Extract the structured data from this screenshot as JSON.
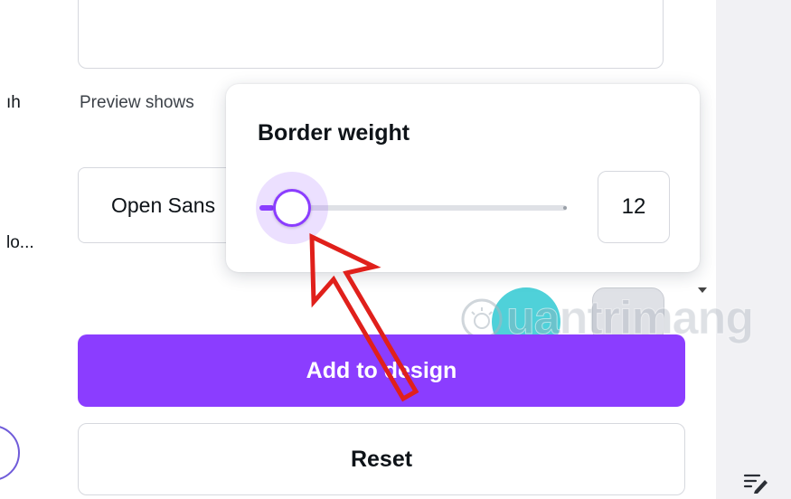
{
  "panel": {
    "left_label_1": "ıh",
    "left_label_2": "lo...",
    "preview_text": "Preview shows",
    "font_value": "Open Sans",
    "add_button_label": "Add to design",
    "reset_button_label": "Reset"
  },
  "popover": {
    "title": "Border weight",
    "slider_value": "12",
    "slider_fraction": 0.12
  },
  "colors": {
    "accent": "#8b3dff",
    "teal_swatch": "#4fd1d9",
    "grey_swatch": "#dfe1e6",
    "annotation_arrow": "#e0201b"
  },
  "watermark": {
    "text": "uantrimang"
  },
  "icons": {
    "notes": "notes-pencil-icon",
    "sun": "sun-logo-icon",
    "annotation": "red-arrow-annotation"
  }
}
